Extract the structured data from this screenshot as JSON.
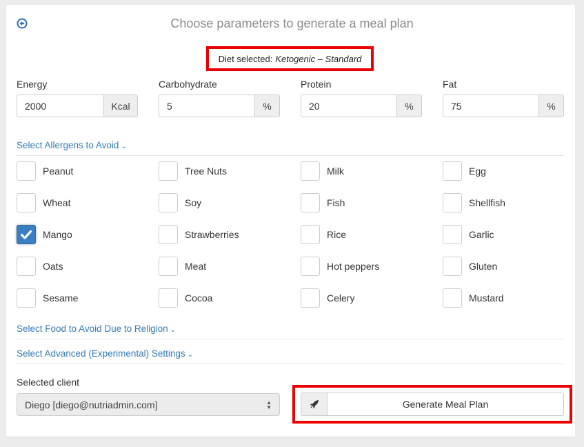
{
  "header": {
    "title": "Choose parameters to generate a meal plan",
    "back_icon": "circle-arrow-left-icon"
  },
  "diet": {
    "label": "Diet selected:",
    "value": "Ketogenic – Standard"
  },
  "macros": [
    {
      "label": "Energy",
      "value": "2000",
      "unit": "Kcal"
    },
    {
      "label": "Carbohydrate",
      "value": "5",
      "unit": "%"
    },
    {
      "label": "Protein",
      "value": "20",
      "unit": "%"
    },
    {
      "label": "Fat",
      "value": "75",
      "unit": "%"
    }
  ],
  "sections": {
    "allergens": "Select Allergens to Avoid",
    "religion": "Select Food to Avoid Due to Religion",
    "advanced": "Select Advanced (Experimental) Settings",
    "chevron": "⌄"
  },
  "allergens": [
    {
      "label": "Peanut",
      "checked": false
    },
    {
      "label": "Tree Nuts",
      "checked": false
    },
    {
      "label": "Milk",
      "checked": false
    },
    {
      "label": "Egg",
      "checked": false
    },
    {
      "label": "Wheat",
      "checked": false
    },
    {
      "label": "Soy",
      "checked": false
    },
    {
      "label": "Fish",
      "checked": false
    },
    {
      "label": "Shellfish",
      "checked": false
    },
    {
      "label": "Mango",
      "checked": true
    },
    {
      "label": "Strawberries",
      "checked": false
    },
    {
      "label": "Rice",
      "checked": false
    },
    {
      "label": "Garlic",
      "checked": false
    },
    {
      "label": "Oats",
      "checked": false
    },
    {
      "label": "Meat",
      "checked": false
    },
    {
      "label": "Hot peppers",
      "checked": false
    },
    {
      "label": "Gluten",
      "checked": false
    },
    {
      "label": "Sesame",
      "checked": false
    },
    {
      "label": "Cocoa",
      "checked": false
    },
    {
      "label": "Celery",
      "checked": false
    },
    {
      "label": "Mustard",
      "checked": false
    }
  ],
  "client": {
    "label": "Selected client",
    "selected": "Diego [diego@nutriadmin.com]"
  },
  "generate": {
    "label": "Generate Meal Plan",
    "icon": "rocket-icon"
  },
  "colors": {
    "link": "#337ab7",
    "checked": "#3a7fc1",
    "highlight": "#ec0000"
  }
}
